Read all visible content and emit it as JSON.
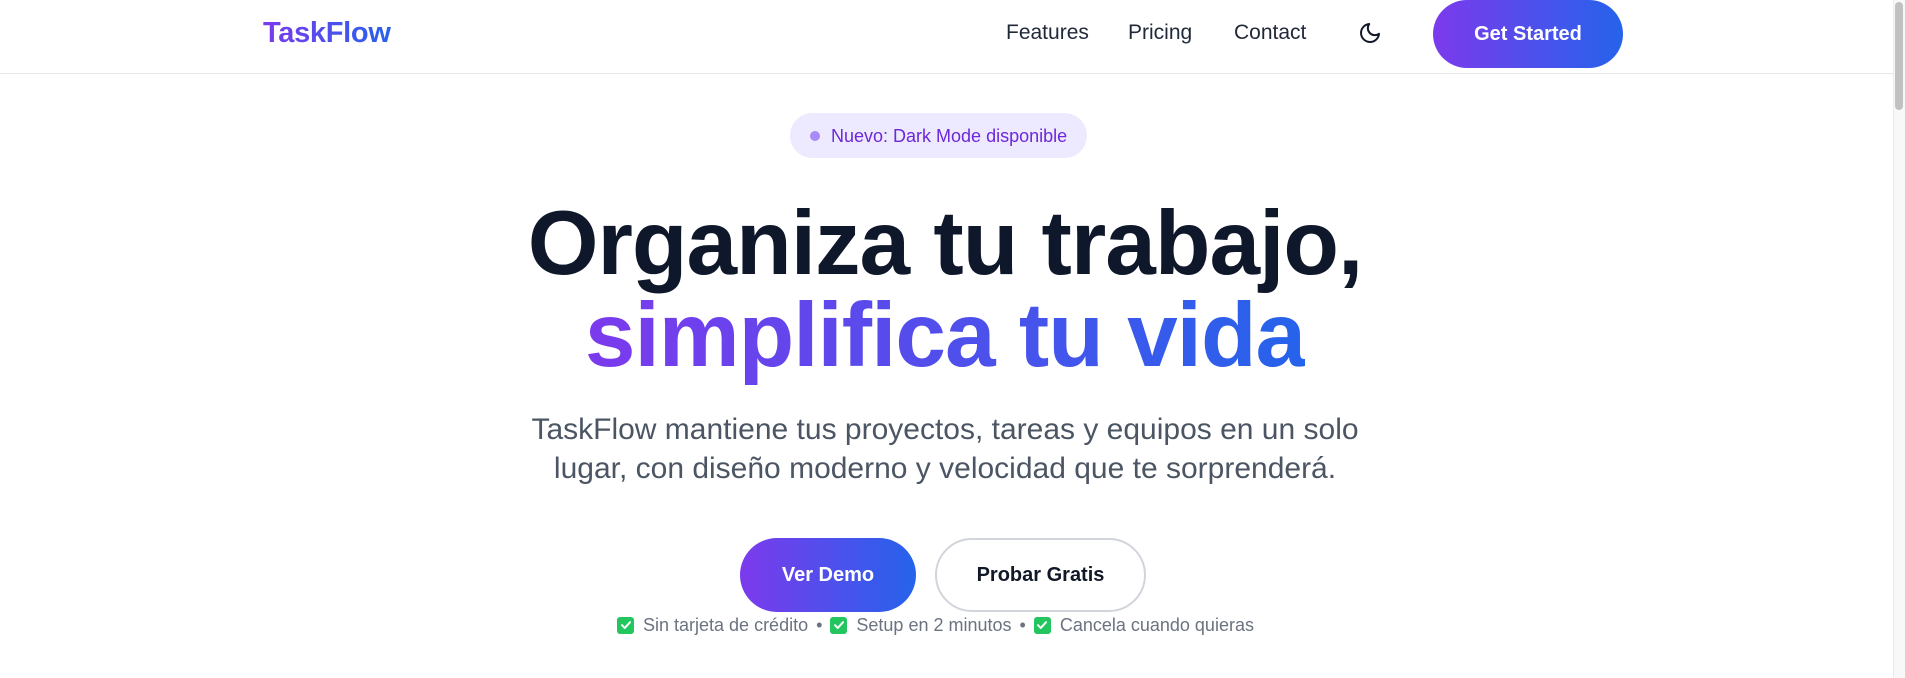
{
  "brand": {
    "name": "TaskFlow",
    "gradient_from": "#7c3aed",
    "gradient_to": "#2563eb"
  },
  "nav": {
    "links": [
      {
        "label": "Features"
      },
      {
        "label": "Pricing"
      },
      {
        "label": "Contact"
      }
    ],
    "theme_toggle_icon": "moon-icon",
    "cta_label": "Get Started"
  },
  "hero": {
    "badge_text": "Nuevo: Dark Mode disponible",
    "title_line1": "Organiza tu trabajo,",
    "title_line2": "simplifica tu vida",
    "subtitle_line1": "TaskFlow mantiene tus proyectos, tareas y equipos en un solo",
    "subtitle_line2": "lugar, con diseño moderno y velocidad que te sorprenderá.",
    "primary_cta": "Ver Demo",
    "secondary_cta": "Probar Gratis",
    "perks": [
      {
        "icon": "check-icon",
        "text": "Sin tarjeta de crédito"
      },
      {
        "icon": "check-icon",
        "text": "Setup en 2 minutos"
      },
      {
        "icon": "check-icon",
        "text": "Cancela cuando quieras"
      }
    ],
    "separator": "•"
  }
}
